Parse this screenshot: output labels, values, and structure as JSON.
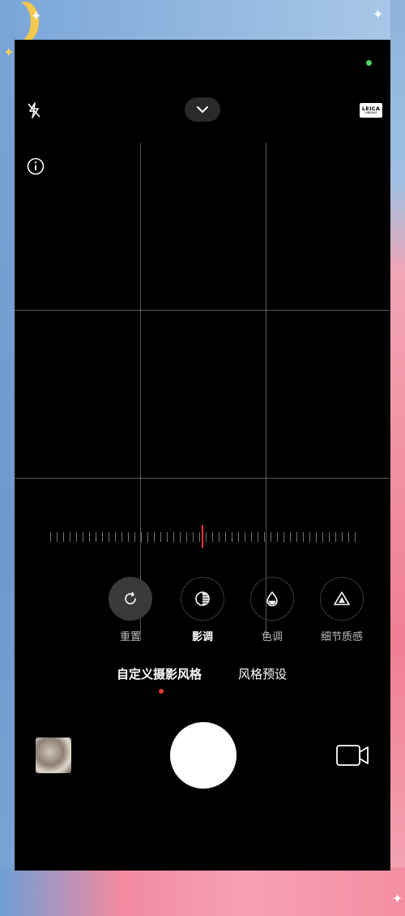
{
  "status": {
    "indicator_color": "#4cd964"
  },
  "top_bar": {
    "flash_icon": "flash-off-icon",
    "collapse_icon": "chevron-down-icon",
    "brand_badge": {
      "line1": "LEICA",
      "line2": "VIBRANT"
    },
    "info_icon": "info-icon"
  },
  "adjustment_ruler": {
    "accent_color": "#e53935"
  },
  "tools": [
    {
      "label": "重置",
      "icon": "reset-icon",
      "active": false
    },
    {
      "label": "影调",
      "icon": "tone-icon",
      "active": true
    },
    {
      "label": "色调",
      "icon": "color-drop-icon",
      "active": false
    },
    {
      "label": "细节质感",
      "icon": "texture-triangle-icon",
      "active": false
    }
  ],
  "modes": [
    {
      "label": "自定义摄影风格",
      "active": true
    },
    {
      "label": "风格预设",
      "active": false
    }
  ],
  "bottom_bar": {
    "gallery_icon": "gallery-thumbnail",
    "shutter": "shutter-button",
    "video_icon": "video-camera-icon"
  }
}
